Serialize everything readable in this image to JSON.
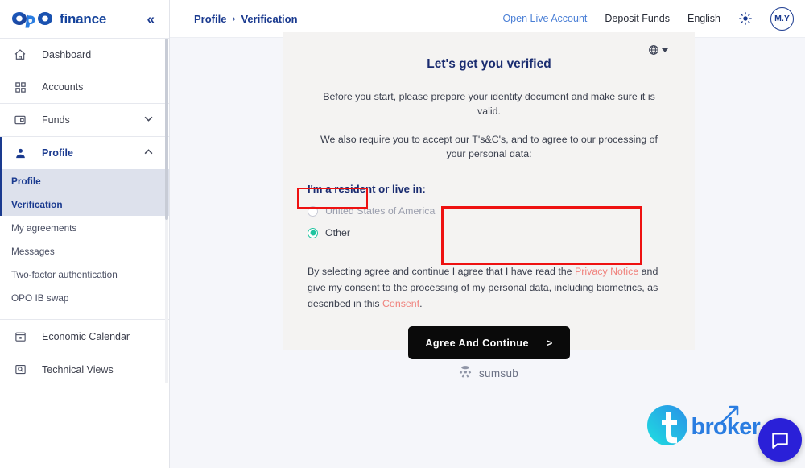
{
  "brand": {
    "logo_text": "finance",
    "logo_icon": "opo-logo-icon",
    "accent_blue": "#15439b",
    "collapse_icon": "«"
  },
  "sidebar": {
    "items": [
      {
        "label": "Dashboard",
        "icon": "home-icon",
        "chevron": ""
      },
      {
        "label": "Accounts",
        "icon": "grid-icon",
        "chevron": ""
      },
      {
        "label": "Funds",
        "icon": "wallet-icon",
        "chevron": "⌄"
      },
      {
        "label": "Profile",
        "icon": "person-icon",
        "chevron": "⌃"
      }
    ],
    "subitems": [
      {
        "label": "Profile"
      },
      {
        "label": "Verification"
      },
      {
        "label": "My agreements"
      },
      {
        "label": "Messages"
      },
      {
        "label": "Two-factor authentication"
      },
      {
        "label": "OPO IB swap"
      }
    ],
    "bottom_items": [
      {
        "label": "Economic Calendar",
        "icon": "calendar-icon"
      },
      {
        "label": "Technical Views",
        "icon": "magnifier-box-icon"
      }
    ]
  },
  "topbar": {
    "breadcrumb": {
      "parent": "Profile",
      "separator": "›",
      "current": "Verification"
    },
    "open_live_account": "Open Live Account",
    "deposit_funds": "Deposit Funds",
    "language": "English",
    "theme_icon": "sun-icon",
    "avatar_initials": "M.Y",
    "link_color": "#4a7fd6"
  },
  "card": {
    "language_icon": "globe-icon",
    "title": "Let's get you verified",
    "paragraph_1": "Before you start, please prepare your identity document and make sure it is valid.",
    "paragraph_2": "We also require you to accept our T's&C's, and to agree to our processing of your personal data:",
    "residency_label": "I'm a resident or live in:",
    "options": [
      {
        "label": "United States of America",
        "selected": false
      },
      {
        "label": "Other",
        "selected": true
      }
    ],
    "selected_color": "#20c4a0",
    "consent": {
      "part1": "By selecting agree and continue I agree that I have read the ",
      "link1": "Privacy Notice",
      "part2": " and give my consent to the processing of my personal data, including biometrics, as described in this ",
      "link2": "Consent",
      "part3": ".",
      "link_color": "#f0827d"
    },
    "agree_button": {
      "label": "Agree And Continue",
      "arrow": ">"
    }
  },
  "annotations": {
    "highlight_color": "#ee1111",
    "boxes": [
      "other-radio-highlight",
      "agree-button-highlight"
    ]
  },
  "footer": {
    "sumsub_text": "sumsub",
    "sumsub_icon": "sumsub-icon",
    "tbroker_text": "broker",
    "tbroker_icon": "tbroker-t-icon",
    "chat_icon": "chat-bubble-icon",
    "chat_bg": "#2a20d8"
  }
}
